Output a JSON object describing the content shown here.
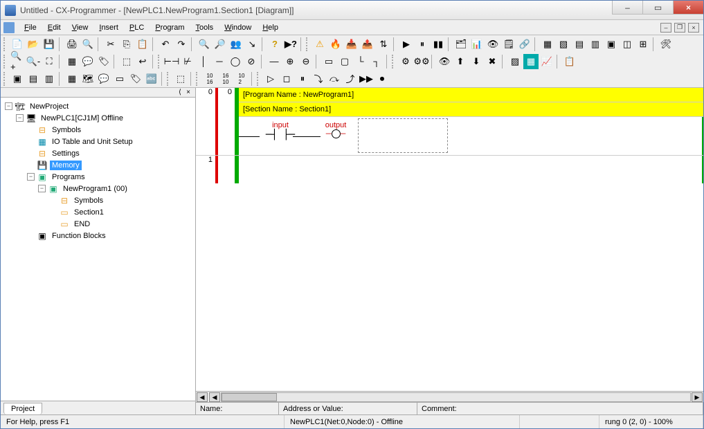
{
  "window": {
    "title": "Untitled - CX-Programmer - [NewPLC1.NewProgram1.Section1 [Diagram]]",
    "minimize_icon": "–",
    "maximize_icon": "▭",
    "close_icon": "×"
  },
  "menu": {
    "items": [
      "File",
      "Edit",
      "View",
      "Insert",
      "PLC",
      "Program",
      "Tools",
      "Window",
      "Help"
    ]
  },
  "sidebar": {
    "tab": "Project",
    "root": "NewProject",
    "plc": "NewPLC1[CJ1M] Offline",
    "items": {
      "symbols": "Symbols",
      "io_table": "IO Table and Unit Setup",
      "settings": "Settings",
      "memory": "Memory",
      "programs": "Programs",
      "newprogram": "NewProgram1 (00)",
      "prog_symbols": "Symbols",
      "section1": "Section1",
      "end": "END",
      "function_blocks": "Function Blocks"
    }
  },
  "ladder": {
    "rung0": {
      "number_left": "0",
      "number_right": "0",
      "program_name_line": "[Program Name : NewProgram1]",
      "section_name_line": "[Section Name : Section1]",
      "contact1_label": "input",
      "coil_label": "output"
    },
    "rung1": {
      "number": "1"
    }
  },
  "info_bar": {
    "name_label": "Name:",
    "address_label": "Address or Value:",
    "comment_label": "Comment:"
  },
  "status_bar": {
    "help": "For Help, press F1",
    "plc_info": "NewPLC1(Net:0,Node:0) - Offline",
    "rung_info": "rung 0 (2, 0)  - 100%"
  }
}
